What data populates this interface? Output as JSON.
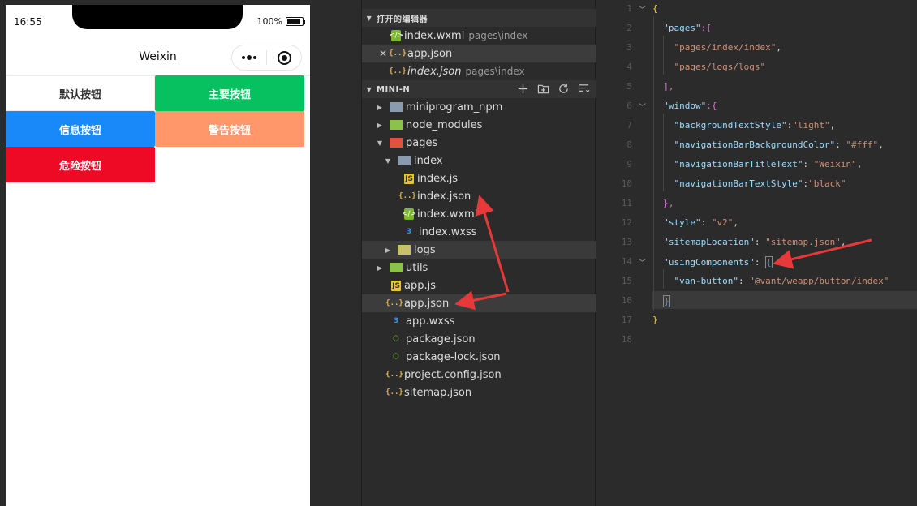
{
  "phone": {
    "time": "16:55",
    "battery": "100%",
    "nav_title": "Weixin",
    "buttons": {
      "default": "默认按钮",
      "primary": "主要按钮",
      "info": "信息按钮",
      "warning": "警告按钮",
      "danger": "危险按钮"
    },
    "colors": {
      "primary": "#07c160",
      "info": "#1989fa",
      "warning": "#ff976a",
      "danger": "#ee0a24"
    }
  },
  "explorer": {
    "open_editors": {
      "title": "打开的编辑器",
      "items": [
        {
          "name": "index.wxml",
          "path": "pages\\index"
        },
        {
          "name": "app.json",
          "path": ""
        },
        {
          "name": "index.json",
          "path": "pages\\index"
        }
      ]
    },
    "project": {
      "title": "MINI-N",
      "items": [
        {
          "name": "miniprogram_npm"
        },
        {
          "name": "node_modules"
        },
        {
          "name": "pages"
        },
        {
          "name": "index"
        },
        {
          "name": "index.js"
        },
        {
          "name": "index.json"
        },
        {
          "name": "index.wxml"
        },
        {
          "name": "index.wxss"
        },
        {
          "name": "logs"
        },
        {
          "name": "utils"
        },
        {
          "name": "app.js"
        },
        {
          "name": "app.json"
        },
        {
          "name": "app.wxss"
        },
        {
          "name": "package.json"
        },
        {
          "name": "package-lock.json"
        },
        {
          "name": "project.config.json"
        },
        {
          "name": "sitemap.json"
        }
      ]
    }
  },
  "editor": {
    "line_numbers": [
      "1",
      "2",
      "3",
      "4",
      "5",
      "6",
      "7",
      "8",
      "9",
      "10",
      "11",
      "12",
      "13",
      "14",
      "15",
      "16",
      "17",
      "18"
    ],
    "code": {
      "l1_brace": "{",
      "l2_key": "\"pages\"",
      "l2_rest": ":[",
      "l3_val": "\"pages/index/index\"",
      "l3_comma": ",",
      "l4_val": "\"pages/logs/logs\"",
      "l5_close": "],",
      "l6_key": "\"window\"",
      "l6_rest": ":{",
      "l7_key": "\"backgroundTextStyle\"",
      "l7_val": "\"light\"",
      "l8_key": "\"navigationBarBackgroundColor\"",
      "l8_val": "\"#fff\"",
      "l9_key": "\"navigationBarTitleText\"",
      "l9_val": "\"Weixin\"",
      "l10_key": "\"navigationBarTextStyle\"",
      "l10_val": "\"black\"",
      "l11_close": "},",
      "l12_key": "\"style\"",
      "l12_val": "\"v2\"",
      "l13_key": "\"sitemapLocation\"",
      "l13_val": "\"sitemap.json\"",
      "l14_key": "\"usingComponents\"",
      "l14_open": "{",
      "l15_key": "\"van-button\"",
      "l15_val": "\"@vant/weapp/button/index\"",
      "l16_close": "}",
      "l17_brace": "}"
    }
  }
}
